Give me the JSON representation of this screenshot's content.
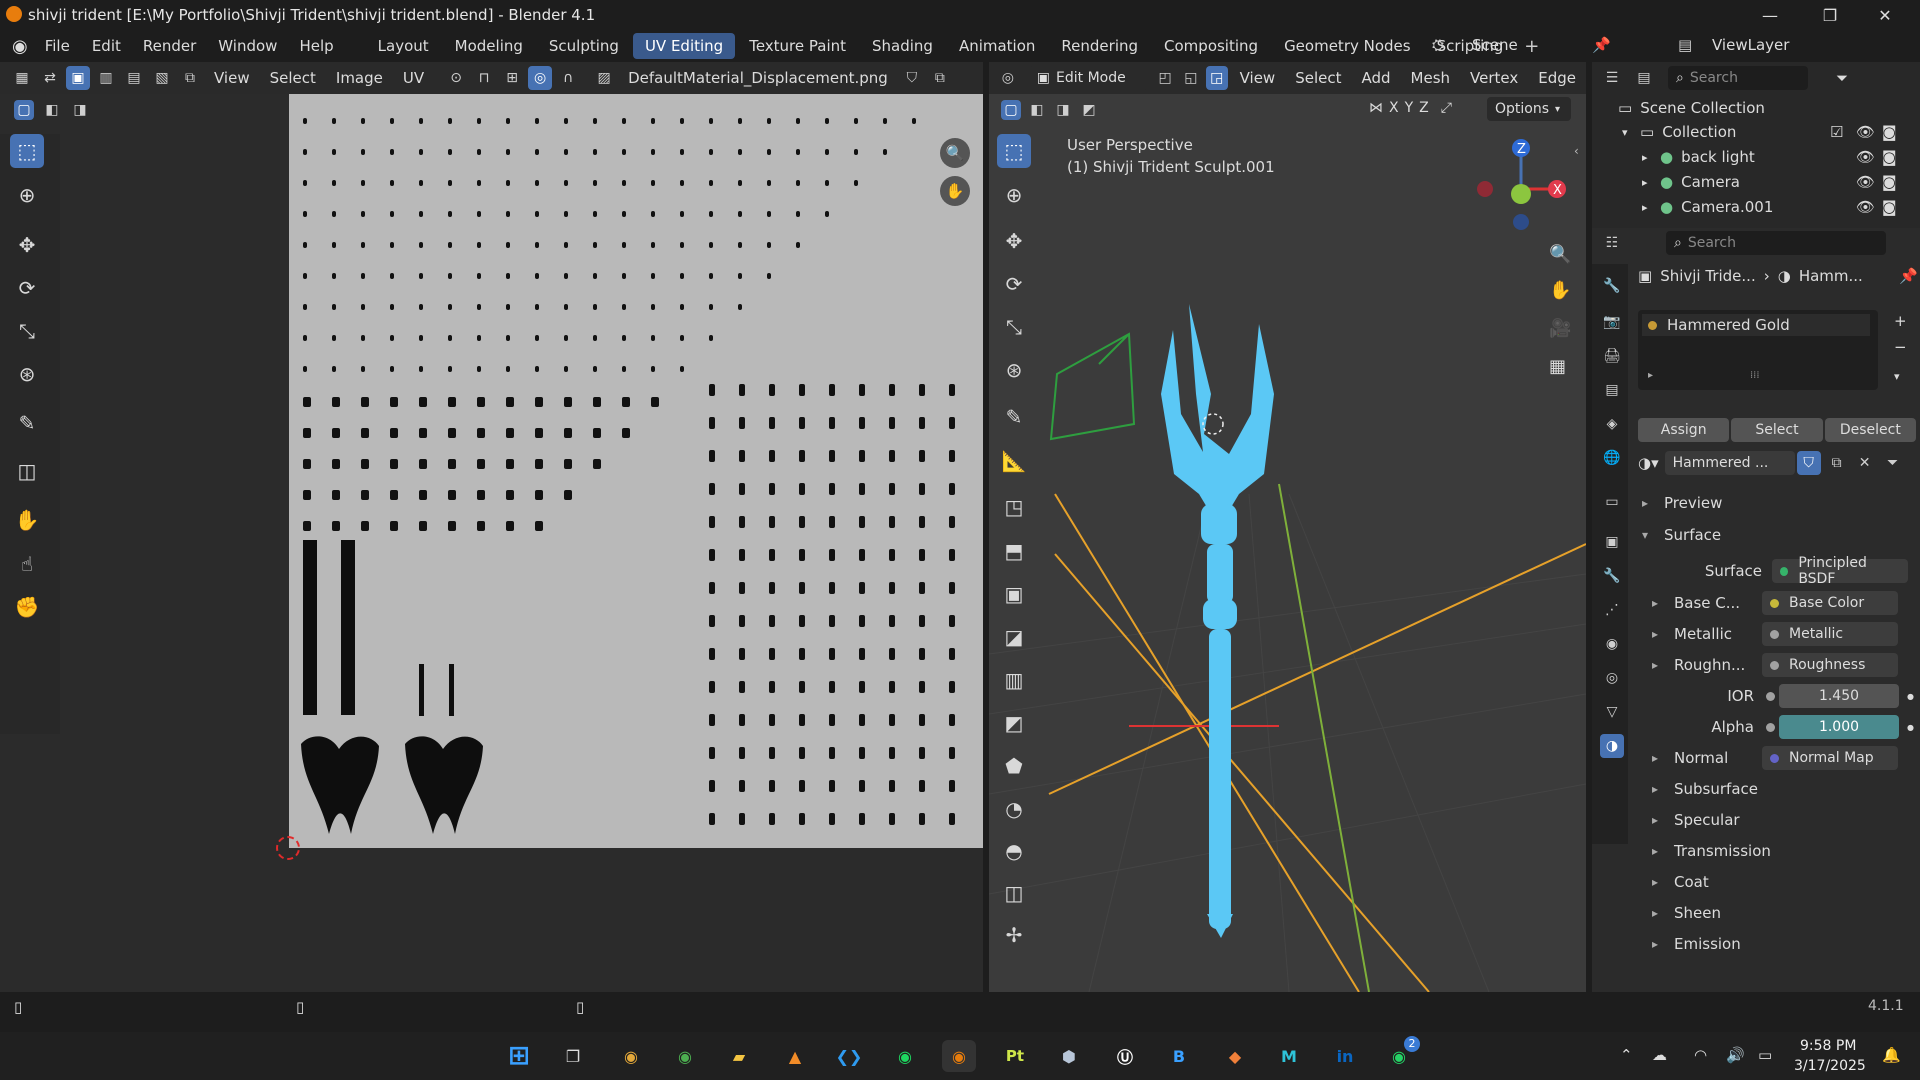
{
  "window": {
    "title": "shivji trident [E:\\My Portfolio\\Shivji Trident\\shivji trident.blend] - Blender 4.1"
  },
  "menu": [
    "File",
    "Edit",
    "Render",
    "Window",
    "Help"
  ],
  "workspaces": [
    {
      "label": "Layout",
      "active": false
    },
    {
      "label": "Modeling",
      "active": false
    },
    {
      "label": "Sculpting",
      "active": false
    },
    {
      "label": "UV Editing",
      "active": true
    },
    {
      "label": "Texture Paint",
      "active": false
    },
    {
      "label": "Shading",
      "active": false
    },
    {
      "label": "Animation",
      "active": false
    },
    {
      "label": "Rendering",
      "active": false
    },
    {
      "label": "Compositing",
      "active": false
    },
    {
      "label": "Geometry Nodes",
      "active": false
    },
    {
      "label": "Scripting",
      "active": false
    }
  ],
  "scene": {
    "name": "Scene",
    "view_layer": "ViewLayer"
  },
  "uv_editor": {
    "menus": [
      "View",
      "Select",
      "Image",
      "UV"
    ],
    "image_name": "DefaultMaterial_Displacement.png"
  },
  "viewport": {
    "mode": "Edit Mode",
    "menus": [
      "View",
      "Select",
      "Add",
      "Mesh",
      "Vertex",
      "Edge"
    ],
    "axes": [
      "X",
      "Y",
      "Z"
    ],
    "options_label": "Options",
    "perspective": "User Perspective",
    "object_label": "(1) Shivji Trident Sculpt.001",
    "gizmo": {
      "z": "Z",
      "x": "X"
    }
  },
  "outliner": {
    "search_placeholder": "Search",
    "root": "Scene Collection",
    "collection": "Collection",
    "items": [
      "back light",
      "Camera",
      "Camera.001"
    ]
  },
  "properties": {
    "search_placeholder": "Search",
    "breadcrumb_object": "Shivji Tride...",
    "breadcrumb_material": "Hamm...",
    "material_slot": "Hammered Gold",
    "assign": "Assign",
    "select": "Select",
    "deselect": "Deselect",
    "material_name": "Hammered ...",
    "sections": {
      "preview": "Preview",
      "surface": "Surface"
    },
    "surface_label": "Surface",
    "surface_value": "Principled BSDF",
    "inputs": [
      {
        "label": "Base C...",
        "value": "Base Color",
        "dot": "#c7b93a"
      },
      {
        "label": "Metallic",
        "value": "Metallic",
        "dot": "#a1a1a1"
      },
      {
        "label": "Roughn...",
        "value": "Roughness",
        "dot": "#a1a1a1"
      }
    ],
    "ior_label": "IOR",
    "ior_value": "1.450",
    "alpha_label": "Alpha",
    "alpha_value": "1.000",
    "normal_label": "Normal",
    "normal_value": "Normal Map",
    "subpanels": [
      "Subsurface",
      "Specular",
      "Transmission",
      "Coat",
      "Sheen",
      "Emission"
    ]
  },
  "status": {
    "version": "4.1.1"
  },
  "taskbar": {
    "time": "9:58 PM",
    "date": "3/17/2025",
    "whatsapp_badge": "2"
  },
  "colors": {
    "accent": "#4772b3",
    "trident": "#5bc8f5",
    "uv_bg": "#b9b9b9"
  }
}
